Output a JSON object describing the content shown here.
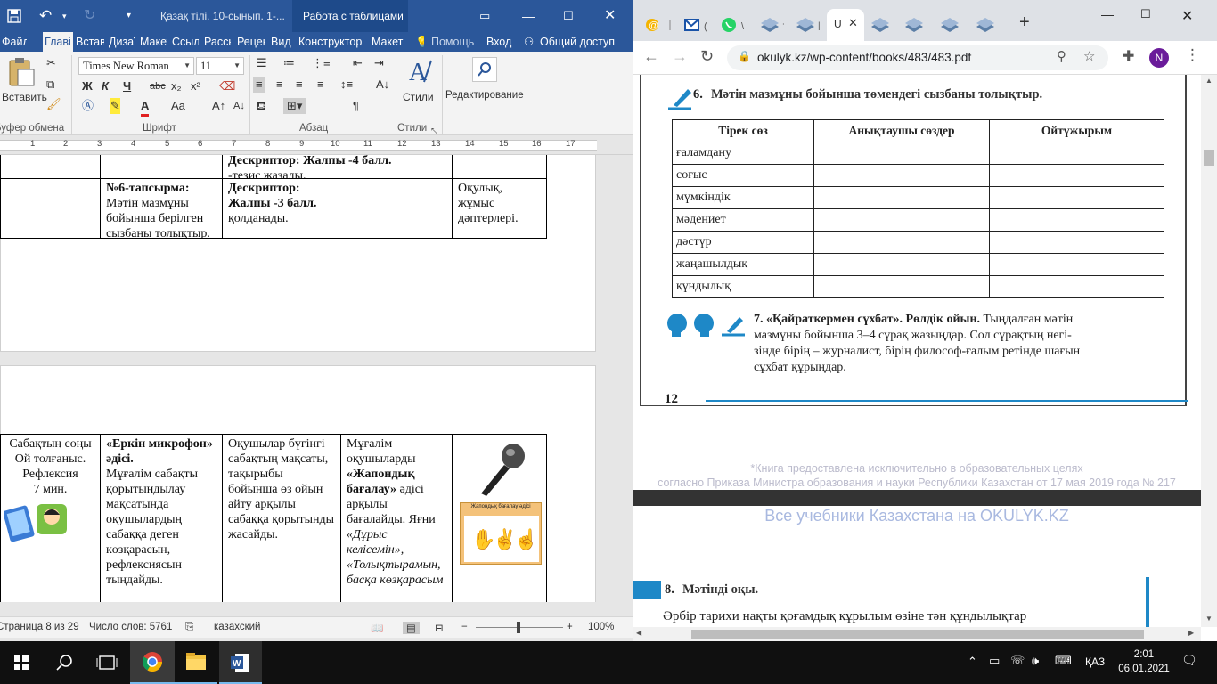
{
  "word": {
    "title_doc": "Қазақ тілі. 10-сынып. 1-...",
    "title_context": "Работа с таблицами",
    "tabs": [
      "Файл",
      "Главі",
      "Встав",
      "Дизаї",
      "Макет",
      "Ссыл",
      "Рассы",
      "Рецен",
      "Вид",
      "Конструктор",
      "Макет"
    ],
    "tell_me": "Помощь",
    "signin": "Вход",
    "share": "Общий доступ",
    "clipboard": {
      "paste_label": "Вставить",
      "group_label": "Буфер обмена"
    },
    "font": {
      "name": "Times New Roman",
      "size": "11",
      "group_label": "Шрифт",
      "bold": "Ж",
      "italic": "К",
      "underline": "Ч",
      "strike": "abc",
      "sub": "x₂",
      "sup": "x²"
    },
    "paragraph": {
      "group_label": "Абзац"
    },
    "styles": {
      "label": "Стили",
      "group_label": "Стили"
    },
    "editing": {
      "label": "Редактирование"
    },
    "ruler_numbers": [
      "1",
      "2",
      "3",
      "4",
      "5",
      "6",
      "7",
      "8",
      "9",
      "10",
      "11",
      "12",
      "13",
      "14",
      "15",
      "16",
      "17"
    ],
    "page1": {
      "row0_c3_line1": "Дескриптор: Жалпы -4 балл.",
      "row0_c3_line2": "-тезис жазады.",
      "row1_c2_title": "№6-тапсырма:",
      "row1_c2_text": "Мәтін мазмұны бойынша берілген сызбаны толықтыр.",
      "row1_c3_title": "Дескриптор:",
      "row1_c3_bold": "Жалпы -3 балл.",
      "row1_c3_text": "қолданады.",
      "row1_c4_text": "Оқулық, жұмыс дәптерлері."
    },
    "page2": {
      "c1_text": "Сабақтың соңы Ой толғаныс. Рефлексия",
      "c1_time": "7 мин.",
      "c2_title": "«Еркін микрофон» әдісі.",
      "c2_text": "Мұғалім сабақты қорытындылау мақсатында оқушылардың сабаққа деген көзқарасын, рефлексиясын тыңдайды.",
      "c3_text": "Оқушылар бүгінгі сабақтың мақсаты, тақырыбы бойынша өз ойын айту арқылы сабаққа қорытынды жасайды.",
      "c4_pre": "Мұғалім оқушыларды",
      "c4_bold": "«Жапондық бағалау»",
      "c4_mid": "әдісі арқылы бағалайды. Яғни",
      "c4_italic": "«Дұрыс келісемін», «Толықтырамын, басқа көзқарасым",
      "poster_title": "Жапондық бағалау әдісі"
    },
    "status": {
      "page": "Страница 8 из 29",
      "words": "Число слов: 5761",
      "lang": "казахский",
      "zoom": "100%"
    }
  },
  "chrome": {
    "tab_active_label": "U",
    "url": "okulyk.kz/wp-content/books/483/483.pdf",
    "profile_initial": "N",
    "pdf": {
      "task6_num": "6.",
      "task6_text": "Мәтін мазмұны бойынша төмендегі сызбаны толықтыр.",
      "table_headers": [
        "Тірек сөз",
        "Анықтаушы сөздер",
        "Ойтұжырым"
      ],
      "table_rows": [
        "ғаламдану",
        "соғыс",
        "мүмкіндік",
        "мәдениет",
        "дәстүр",
        "жаңашылдық",
        "құндылық"
      ],
      "task7_num": "7.",
      "task7_title": "«Қайраткермен сұхбат». Рөлдік ойын.",
      "task7_line1": "Тыңдалған мәтін",
      "task7_line2": "мазмұны бойынша 3–4 сұрақ жазыңдар. Сол сұрақтың негі-",
      "task7_line3": "зінде бірің – журналист, бірің философ-ғалым ретінде шағын",
      "task7_line4": "сұхбат құрыңдар.",
      "page_number": "12",
      "footer_line1": "*Книга предоставлена исключительно в образовательных целях",
      "footer_line2": "согласно Приказа Министра образования и науки Республики Казахстан от 17 мая 2019 года № 217",
      "watermark": "Все учебники Казахстана на OKULYK.KZ",
      "task8_num": "8.",
      "task8_text": "Мәтінді оқы.",
      "task8_body": "Әрбір тарихи нақты қоғамдық құрылым өзіне тән құндылықтар"
    }
  },
  "taskbar": {
    "lang": "ҚАЗ",
    "time": "2:01",
    "date": "06.01.2021"
  },
  "colors": {
    "word_blue": "#2b579a",
    "chrome_tab_bg": "#dee1e6",
    "pdf_accent": "#1e88c7",
    "taskbar": "#101010"
  }
}
